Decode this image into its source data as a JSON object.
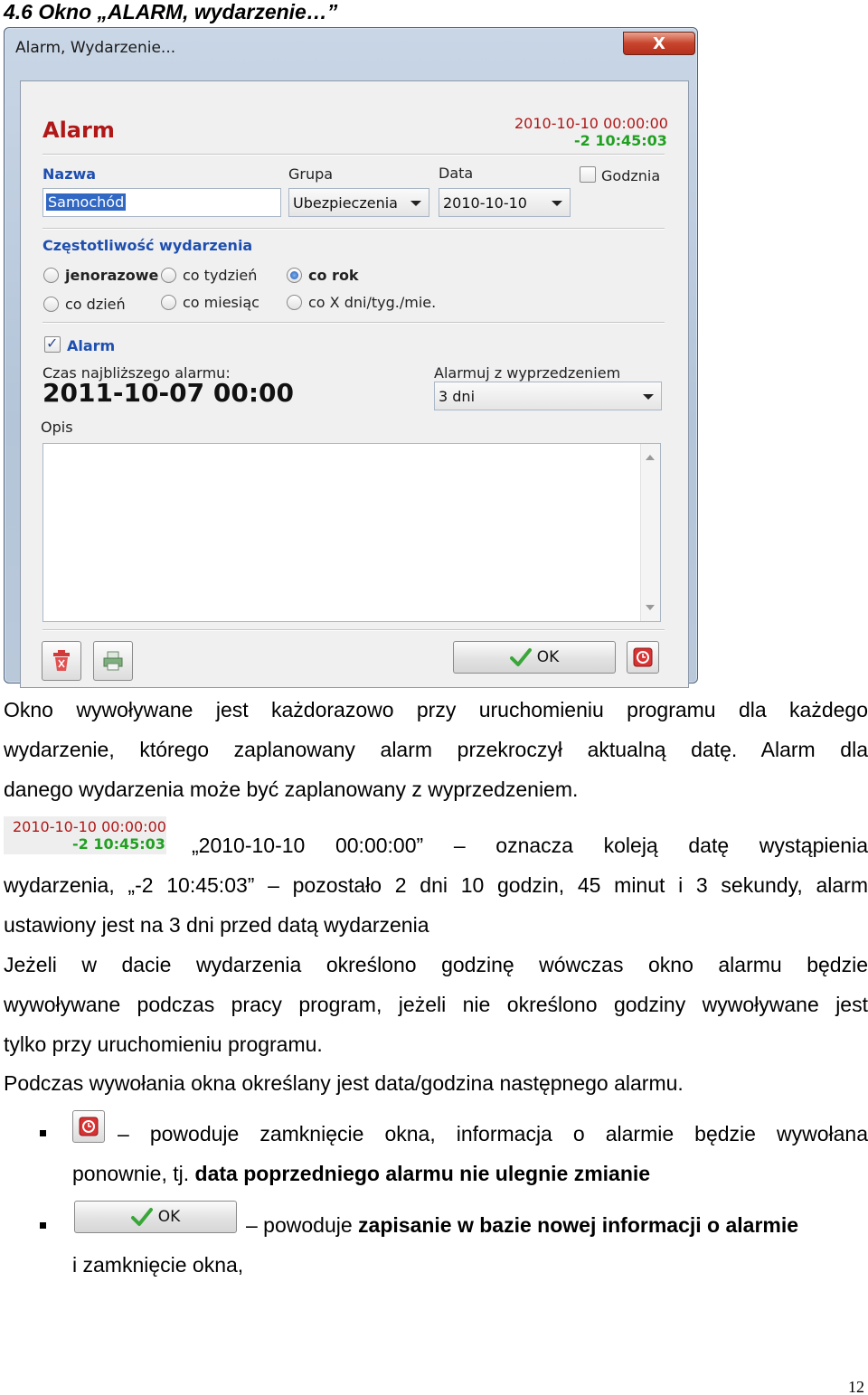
{
  "heading": "4.6 Okno „ALARM, wydarzenie…”",
  "window": {
    "title": "Alarm, Wydarzenie...",
    "close_label": "X",
    "alarm_title": "Alarm",
    "event_datetime": "2010-10-10 00:00:00",
    "remaining": "-2 10:45:03",
    "name_label": "Nazwa",
    "name_value": "Samochód",
    "group_label": "Grupa",
    "group_value": "Ubezpieczenia",
    "date_label": "Data",
    "date_value": "2010-10-10",
    "hour_checkbox_label": "Godznia",
    "frequency_label": "Częstotliwość wydarzenia",
    "freq": {
      "once": "jenorazowe",
      "weekly": "co tydzień",
      "yearly": "co rok",
      "daily": "co dzień",
      "monthly": "co miesiąc",
      "custom": "co X dni/tyg./mie."
    },
    "alarm_checkbox_label": "Alarm",
    "next_alarm_label": "Czas najbliższego alarmu:",
    "next_alarm_value": "2011-10-07 00:00",
    "advance_label": "Alarmuj z wyprzedzeniem",
    "advance_value": "3 dni",
    "notes_label": "Opis",
    "notes_value": "",
    "ok_label": "OK"
  },
  "body": {
    "p1": [
      "Okno wywoływane jest każdorazowo przy uruchomieniu programu dla każdego",
      "wydarzenie, którego zaplanowany alarm przekroczył aktualną datę. Alarm dla",
      "danego wydarzenia może być zaplanowany z wyprzedzeniem."
    ],
    "mini_date": "2010-10-10 00:00:00",
    "mini_rem": "-2 10:45:03",
    "p2_line1": "„2010-10-10 00:00:00” – oznacza koleją datę wystąpienia",
    "p2_line2": "wydarzenia, „-2 10:45:03” – pozostało 2 dni 10 godzin, 45 minut i 3 sekundy, alarm",
    "p2_line3": "ustawiony jest na  3 dni przed datą wydarzenia",
    "p3": [
      "Jeżeli w dacie wydarzenia określono godzinę wówczas okno alarmu będzie",
      "wywoływane podczas pracy program, jeżeli nie określono godziny wywoływane jest",
      "tylko przy uruchomieniu programu."
    ],
    "p4": "Podczas wywołania okna określany jest data/godzina następnego alarmu.",
    "b1_line1": "– powoduje zamknięcie okna, informacja o alarmie będzie wywołana",
    "b1_line2_normal": "ponownie, tj. ",
    "b1_line2_bold": "data poprzedniego alarmu nie ulegnie zmianie",
    "b2_line1_normal": "– powoduje ",
    "b2_line1_bold": "zapisanie w bazie nowej informacji o alarmie",
    "b2_line2": "i zamknięcie okna,",
    "page_number": "12"
  },
  "colors": {
    "red": "#b01818",
    "green": "#22a022",
    "blue": "#1e4fb0",
    "selection": "#3168c3"
  }
}
